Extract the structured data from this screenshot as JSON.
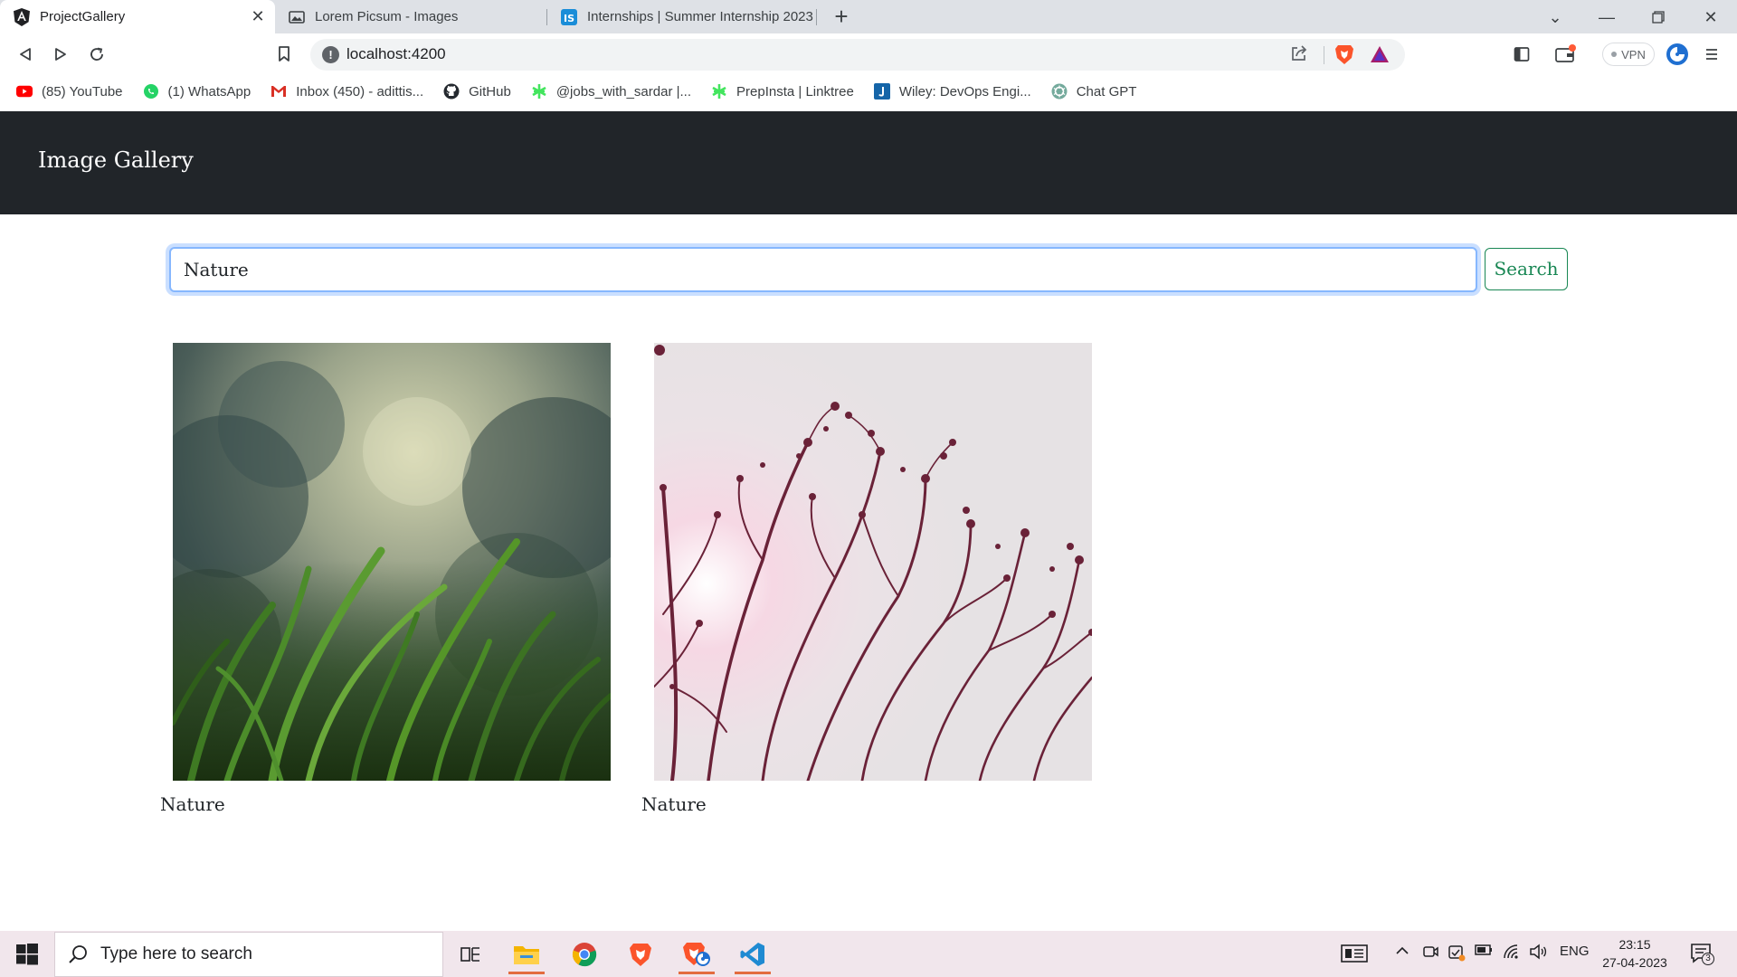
{
  "browser": {
    "tabs": [
      {
        "title": "ProjectGallery",
        "active": true
      },
      {
        "title": "Lorem Picsum - Images",
        "active": false
      },
      {
        "title": "Internships | Summer Internship 2023",
        "active": false
      }
    ],
    "address": "localhost:4200",
    "vpn_label": "VPN",
    "bookmarks": [
      {
        "label": "(85) YouTube",
        "icon": "youtube-icon"
      },
      {
        "label": "(1) WhatsApp",
        "icon": "whatsapp-icon"
      },
      {
        "label": "Inbox (450) - adittis...",
        "icon": "gmail-icon"
      },
      {
        "label": "GitHub",
        "icon": "github-icon"
      },
      {
        "label": "@jobs_with_sardar |...",
        "icon": "linktree-icon"
      },
      {
        "label": "PrepInsta | Linktree",
        "icon": "linktree-icon"
      },
      {
        "label": "Wiley: DevOps Engi...",
        "icon": "wiley-icon"
      },
      {
        "label": "Chat GPT",
        "icon": "chatgpt-icon"
      }
    ]
  },
  "page": {
    "brand": "Image Gallery",
    "search": {
      "value": "Nature",
      "button_label": "Search"
    },
    "cards": [
      {
        "caption": "Nature",
        "image": "grass-photo"
      },
      {
        "caption": "Nature",
        "image": "branches-photo"
      }
    ]
  },
  "taskbar": {
    "search_placeholder": "Type here to search",
    "language": "ENG",
    "time": "23:15",
    "date": "27-04-2023",
    "notification_count": "3"
  },
  "colors": {
    "navbar": "#212529",
    "search_focus": "#86b7fe",
    "success": "#198754"
  }
}
